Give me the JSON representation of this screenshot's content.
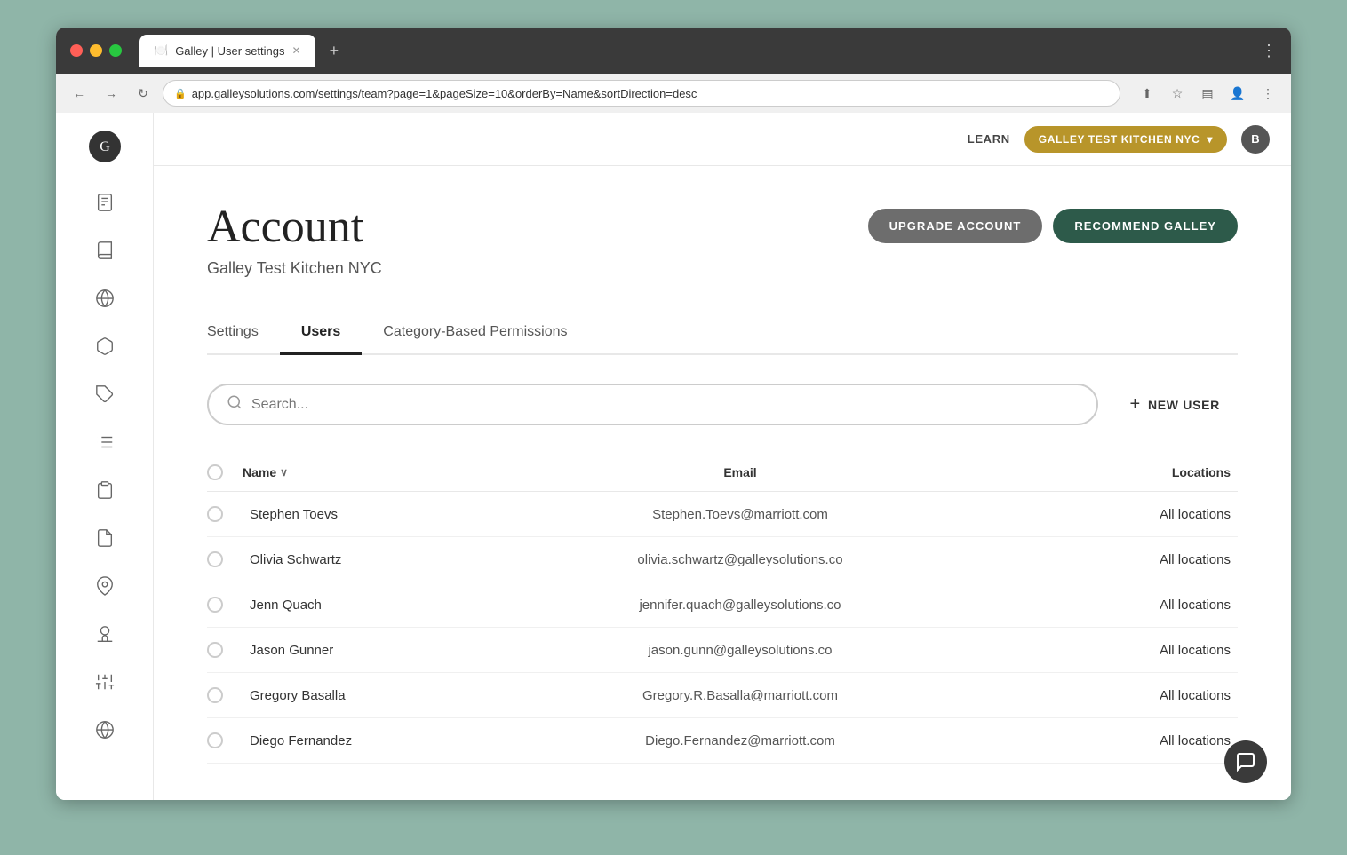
{
  "browser": {
    "tab_title": "Galley | User settings",
    "url": "app.galleysolutions.com/settings/team?page=1&pageSize=10&orderBy=Name&sortDirection=desc",
    "tab_new_label": "+",
    "nav_back": "←",
    "nav_forward": "→",
    "nav_reload": "↻",
    "chevron_down": "▾"
  },
  "topbar": {
    "learn_label": "LEARN",
    "org_name": "GALLEY TEST KITCHEN NYC",
    "avatar_initial": "B"
  },
  "page": {
    "title": "Account",
    "subtitle": "Galley Test Kitchen NYC"
  },
  "buttons": {
    "upgrade": "UPGRADE ACCOUNT",
    "recommend": "RECOMMEND GALLEY",
    "new_user": "NEW USER"
  },
  "tabs": [
    {
      "id": "settings",
      "label": "Settings",
      "active": false
    },
    {
      "id": "users",
      "label": "Users",
      "active": true
    },
    {
      "id": "permissions",
      "label": "Category-Based Permissions",
      "active": false
    }
  ],
  "search": {
    "placeholder": "Search..."
  },
  "table": {
    "columns": [
      {
        "id": "name",
        "label": "Name",
        "sortable": true
      },
      {
        "id": "email",
        "label": "Email",
        "sortable": false
      },
      {
        "id": "locations",
        "label": "Locations",
        "sortable": false
      }
    ],
    "rows": [
      {
        "name": "Stephen Toevs",
        "email": "Stephen.Toevs@marriott.com",
        "locations": "All locations"
      },
      {
        "name": "Olivia Schwartz",
        "email": "olivia.schwartz@galleysolutions.co",
        "locations": "All locations"
      },
      {
        "name": "Jenn Quach",
        "email": "jennifer.quach@galleysolutions.co",
        "locations": "All locations"
      },
      {
        "name": "Jason Gunner",
        "email": "jason.gunn@galleysolutions.co",
        "locations": "All locations"
      },
      {
        "name": "Gregory Basalla",
        "email": "Gregory.R.Basalla@marriott.com",
        "locations": "All locations"
      },
      {
        "name": "Diego Fernandez",
        "email": "Diego.Fernandez@marriott.com",
        "locations": "All locations"
      }
    ]
  },
  "sidebar": {
    "items": [
      {
        "id": "recipes",
        "icon": "📋"
      },
      {
        "id": "books",
        "icon": "📖"
      },
      {
        "id": "globe",
        "icon": "🌍"
      },
      {
        "id": "package",
        "icon": "📦"
      },
      {
        "id": "tag",
        "icon": "🏷️"
      },
      {
        "id": "list",
        "icon": "📊"
      },
      {
        "id": "clipboard",
        "icon": "📋"
      },
      {
        "id": "document",
        "icon": "📄"
      },
      {
        "id": "location",
        "icon": "📍"
      },
      {
        "id": "chef",
        "icon": "🍽️"
      },
      {
        "id": "settings",
        "icon": "⚙️"
      },
      {
        "id": "globe2",
        "icon": "🌐"
      }
    ]
  },
  "colors": {
    "org_bg": "#b8952a",
    "recommend_bg": "#2d5a4a",
    "upgrade_bg": "#6d6d6d",
    "tab_active_border": "#222222"
  }
}
